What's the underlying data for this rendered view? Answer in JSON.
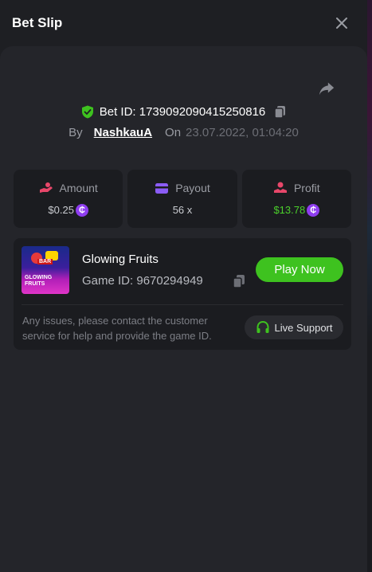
{
  "modal": {
    "title": "Bet Slip"
  },
  "bet": {
    "bet_id_label": "Bet ID: 1739092090415250816",
    "by_label": "By",
    "username": "NashkauA",
    "on_label": "On",
    "datetime": "23.07.2022, 01:04:20"
  },
  "stats": {
    "amount": {
      "label": "Amount",
      "value": "$0.25"
    },
    "payout": {
      "label": "Payout",
      "value": "56 x"
    },
    "profit": {
      "label": "Profit",
      "value": "$13.78"
    },
    "coin_symbol": "₵"
  },
  "game": {
    "name": "Glowing Fruits",
    "game_id_label": "Game ID: 9670294949",
    "thumb_title_line1": "GLOWING",
    "thumb_title_line2": "FRUITS",
    "thumb_bar": "BAR",
    "play_label": "Play Now",
    "issue_text": "Any issues, please contact the customer service for help and provide the game ID.",
    "support_label": "Live Support"
  },
  "colors": {
    "accent_green": "#3ec21f",
    "profit_green": "#4bd02b",
    "coin_purple": "#8f3df0",
    "amount_icon": "#e8476a",
    "payout_icon": "#8b5cf6",
    "profit_icon": "#e8476a"
  }
}
